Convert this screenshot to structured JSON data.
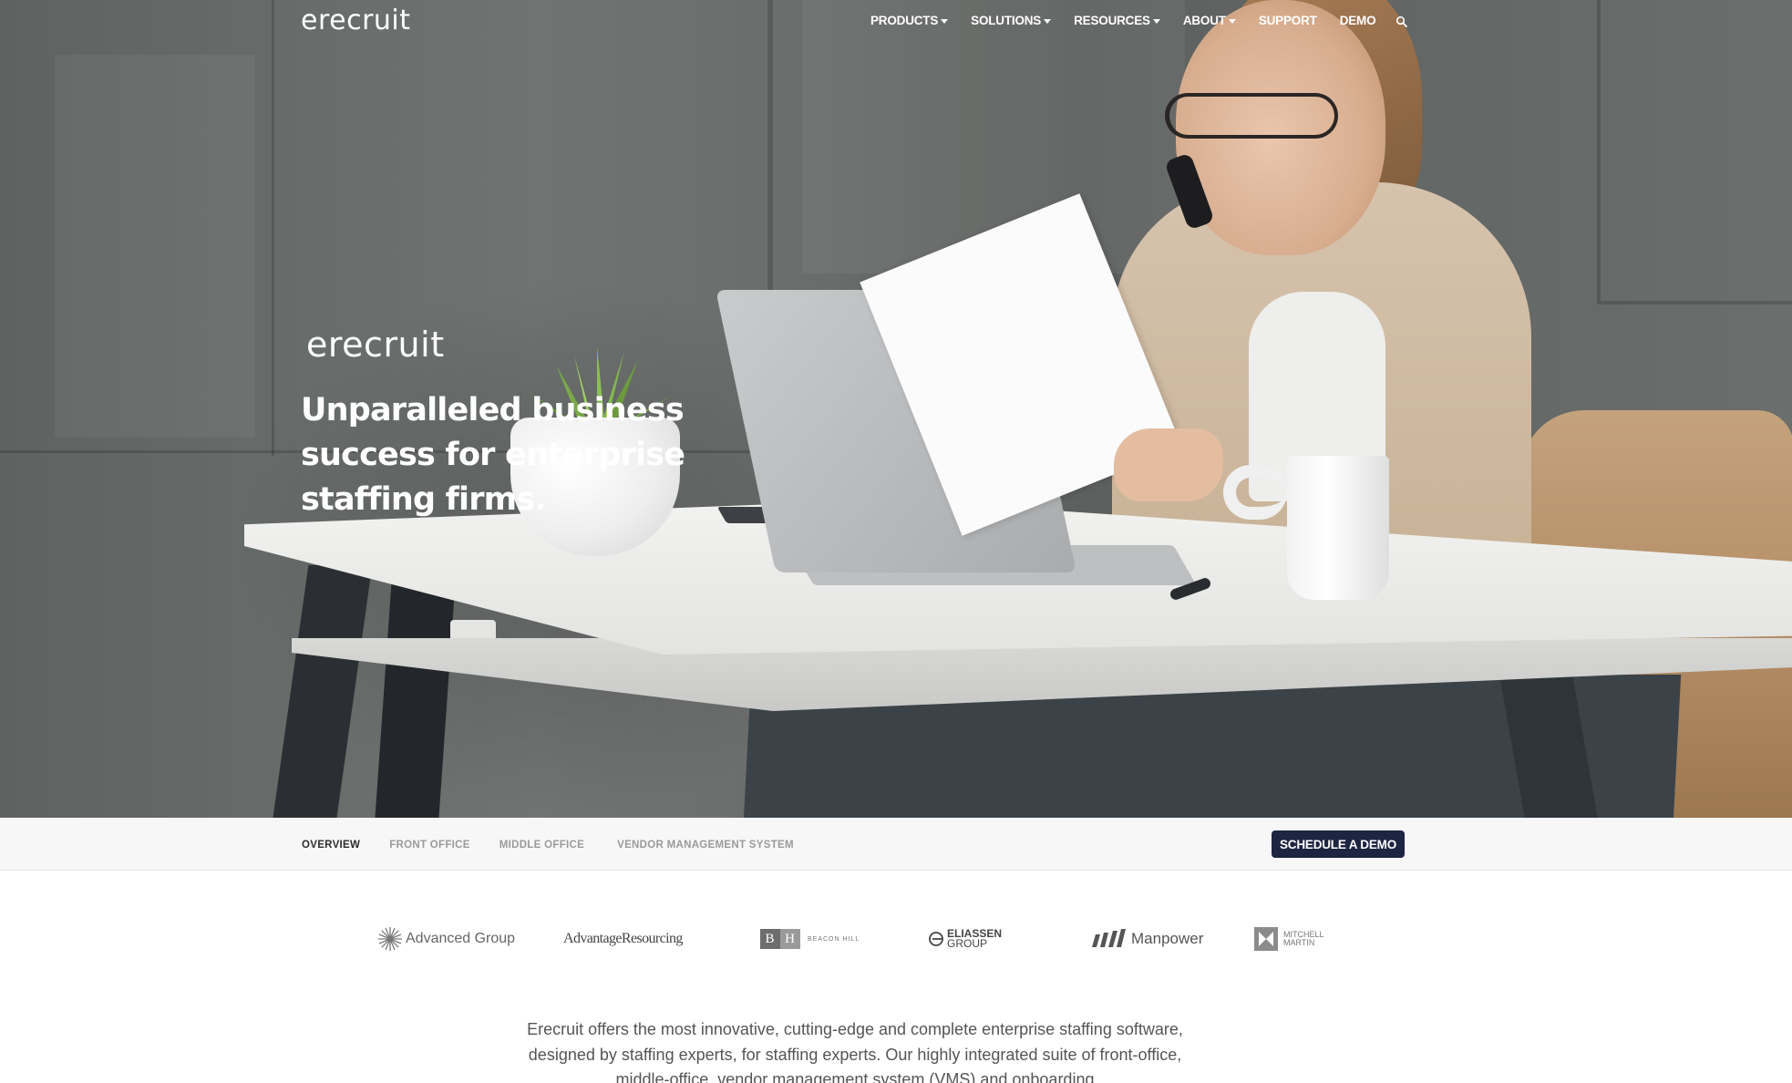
{
  "brand": {
    "logo_text": "erecruit"
  },
  "nav": {
    "items": [
      {
        "label": "PRODUCTS",
        "has_dropdown": true
      },
      {
        "label": "SOLUTIONS",
        "has_dropdown": true
      },
      {
        "label": "RESOURCES",
        "has_dropdown": true
      },
      {
        "label": "ABOUT",
        "has_dropdown": true
      },
      {
        "label": "SUPPORT",
        "has_dropdown": false
      },
      {
        "label": "DEMO",
        "has_dropdown": false
      }
    ],
    "search_icon": "search-icon"
  },
  "hero": {
    "logo_text": "erecruit",
    "headline": "Unparalleled business success for enterprise staffing firms."
  },
  "subnav": {
    "tabs": [
      {
        "label": "OVERVIEW",
        "active": true
      },
      {
        "label": "FRONT OFFICE",
        "active": false
      },
      {
        "label": "MIDDLE OFFICE",
        "active": false
      },
      {
        "label": "VENDOR MANAGEMENT SYSTEM",
        "active": false
      }
    ],
    "cta_label": "SCHEDULE A DEMO"
  },
  "clients": {
    "advanced_group": "Advanced Group",
    "advantage_resourcing": "AdvantageResourcing",
    "beacon_hill_letters": [
      "B",
      "H"
    ],
    "beacon_hill_name": "BEACON HILL",
    "eliassen_line1": "ELIASSEN",
    "eliassen_line2": "GROUP",
    "manpower": "Manpower",
    "mitchell_line1": "MITCHELL",
    "mitchell_line2": "MARTIN"
  },
  "intro": {
    "text": "Erecruit offers the most innovative, cutting-edge and complete enterprise staffing software, designed by staffing experts, for staffing experts. Our highly integrated suite of front-office, middle-office, vendor management system (VMS) and onboarding"
  },
  "colors": {
    "cta_bg": "#1c2541",
    "nav_text": "#ffffff",
    "tab_active": "#2d2d2d",
    "tab_inactive": "#9a9a9a"
  }
}
